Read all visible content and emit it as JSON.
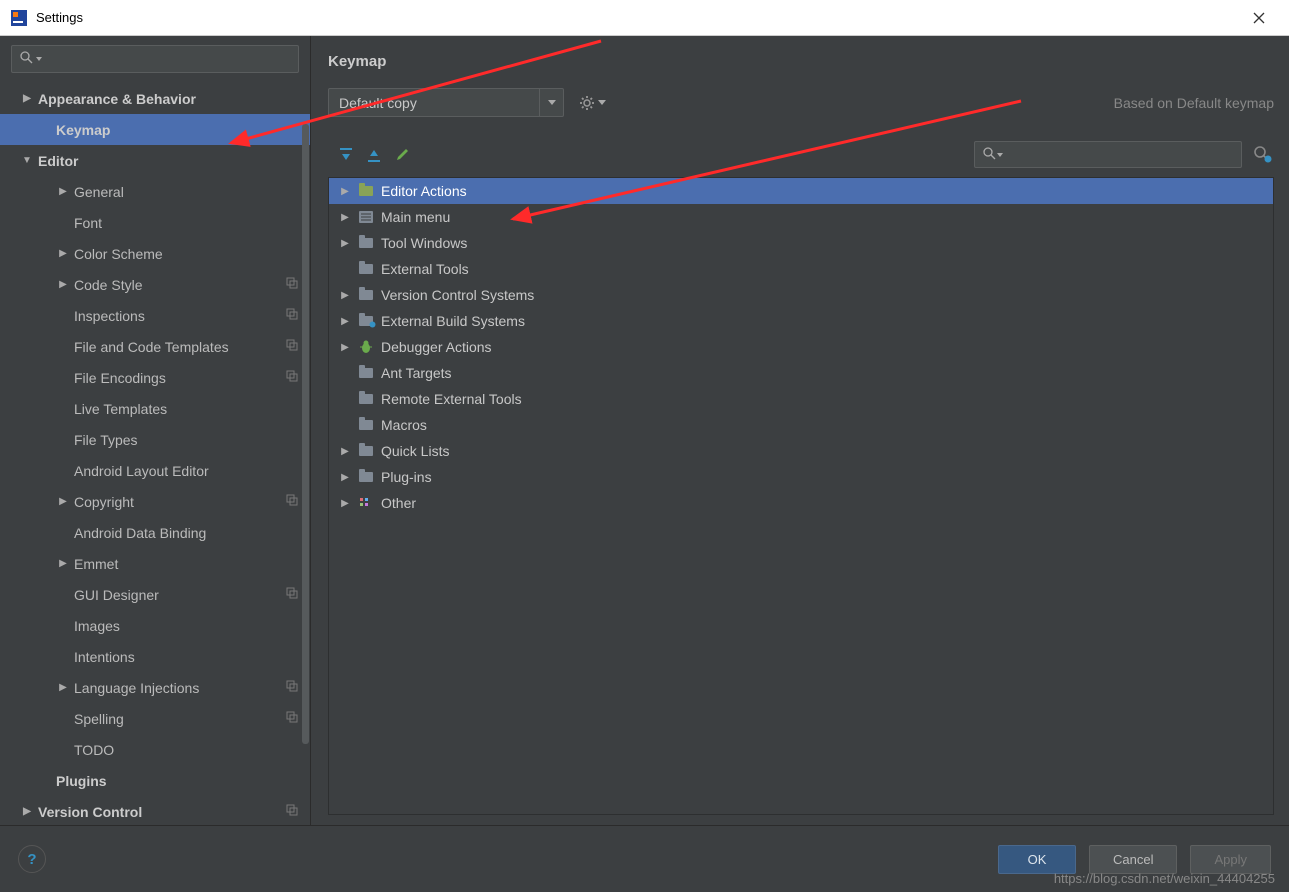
{
  "window": {
    "title": "Settings"
  },
  "sidebar": {
    "items": [
      {
        "label": "Appearance & Behavior",
        "level": 0,
        "expandable": true,
        "expanded": false,
        "bold": true
      },
      {
        "label": "Keymap",
        "level": 1,
        "expandable": false,
        "bold": true,
        "selected": true
      },
      {
        "label": "Editor",
        "level": 0,
        "expandable": true,
        "expanded": true,
        "bold": true
      },
      {
        "label": "General",
        "level": 2,
        "expandable": true,
        "expanded": false
      },
      {
        "label": "Font",
        "level": 2,
        "expandable": false
      },
      {
        "label": "Color Scheme",
        "level": 2,
        "expandable": true,
        "expanded": false
      },
      {
        "label": "Code Style",
        "level": 2,
        "expandable": true,
        "expanded": false,
        "copy": true
      },
      {
        "label": "Inspections",
        "level": 2,
        "expandable": false,
        "copy": true
      },
      {
        "label": "File and Code Templates",
        "level": 2,
        "expandable": false,
        "copy": true
      },
      {
        "label": "File Encodings",
        "level": 2,
        "expandable": false,
        "copy": true
      },
      {
        "label": "Live Templates",
        "level": 2,
        "expandable": false
      },
      {
        "label": "File Types",
        "level": 2,
        "expandable": false
      },
      {
        "label": "Android Layout Editor",
        "level": 2,
        "expandable": false
      },
      {
        "label": "Copyright",
        "level": 2,
        "expandable": true,
        "expanded": false,
        "copy": true
      },
      {
        "label": "Android Data Binding",
        "level": 2,
        "expandable": false
      },
      {
        "label": "Emmet",
        "level": 2,
        "expandable": true,
        "expanded": false
      },
      {
        "label": "GUI Designer",
        "level": 2,
        "expandable": false,
        "copy": true
      },
      {
        "label": "Images",
        "level": 2,
        "expandable": false
      },
      {
        "label": "Intentions",
        "level": 2,
        "expandable": false
      },
      {
        "label": "Language Injections",
        "level": 2,
        "expandable": true,
        "expanded": false,
        "copy": true
      },
      {
        "label": "Spelling",
        "level": 2,
        "expandable": false,
        "copy": true
      },
      {
        "label": "TODO",
        "level": 2,
        "expandable": false
      },
      {
        "label": "Plugins",
        "level": 1,
        "expandable": false,
        "bold": true
      },
      {
        "label": "Version Control",
        "level": 0,
        "expandable": true,
        "expanded": false,
        "bold": true,
        "copy": true
      }
    ]
  },
  "panel": {
    "title": "Keymap",
    "scheme": "Default copy",
    "based_on": "Based on Default keymap",
    "actions": [
      {
        "label": "Editor Actions",
        "arrow": true,
        "icon": "folder-open",
        "selected": true
      },
      {
        "label": "Main menu",
        "arrow": true,
        "icon": "menu"
      },
      {
        "label": "Tool Windows",
        "arrow": true,
        "icon": "folder"
      },
      {
        "label": "External Tools",
        "arrow": false,
        "icon": "folder"
      },
      {
        "label": "Version Control Systems",
        "arrow": true,
        "icon": "folder"
      },
      {
        "label": "External Build Systems",
        "arrow": true,
        "icon": "folder-gear"
      },
      {
        "label": "Debugger Actions",
        "arrow": true,
        "icon": "bug"
      },
      {
        "label": "Ant Targets",
        "arrow": false,
        "icon": "ant"
      },
      {
        "label": "Remote External Tools",
        "arrow": false,
        "icon": "folder"
      },
      {
        "label": "Macros",
        "arrow": false,
        "icon": "folder"
      },
      {
        "label": "Quick Lists",
        "arrow": true,
        "icon": "folder"
      },
      {
        "label": "Plug-ins",
        "arrow": true,
        "icon": "folder"
      },
      {
        "label": "Other",
        "arrow": true,
        "icon": "other"
      }
    ]
  },
  "buttons": {
    "ok": "OK",
    "cancel": "Cancel",
    "apply": "Apply"
  },
  "watermark": "https://blog.csdn.net/weixin_44404255"
}
